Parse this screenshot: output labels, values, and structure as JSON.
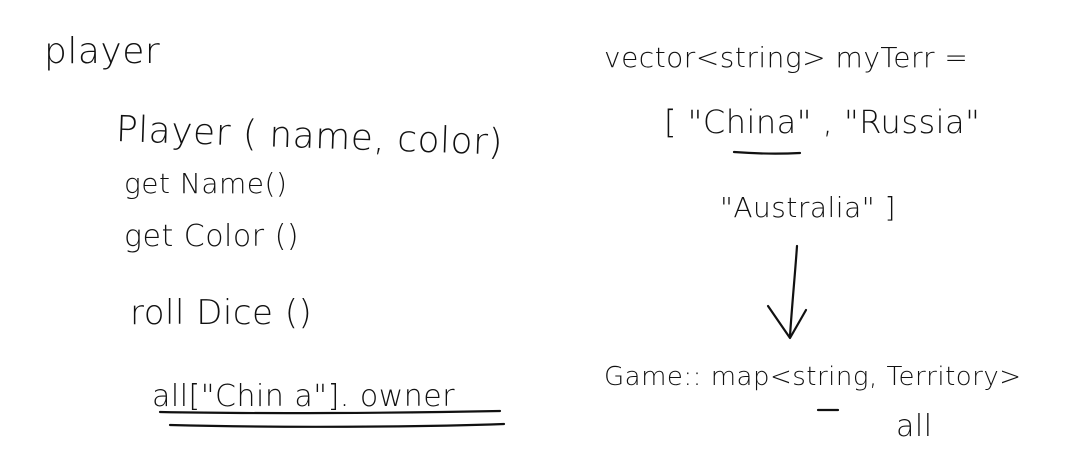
{
  "left": {
    "heading": "player",
    "constructor": "Player ( name, color)",
    "methods": [
      "get Name()",
      "get Color ()",
      "roll Dice ()"
    ],
    "access_expr": "all[\"Chin a\"]. owner"
  },
  "right": {
    "vector_decl": "vector<string> myTerr =",
    "list_line1": "[ \"China\" , \"Russia\"",
    "list_line2": "\"Australia\" ]",
    "map_decl": "Game:: map<string, Territory>",
    "map_name": "all"
  },
  "ink_color": "#111111"
}
